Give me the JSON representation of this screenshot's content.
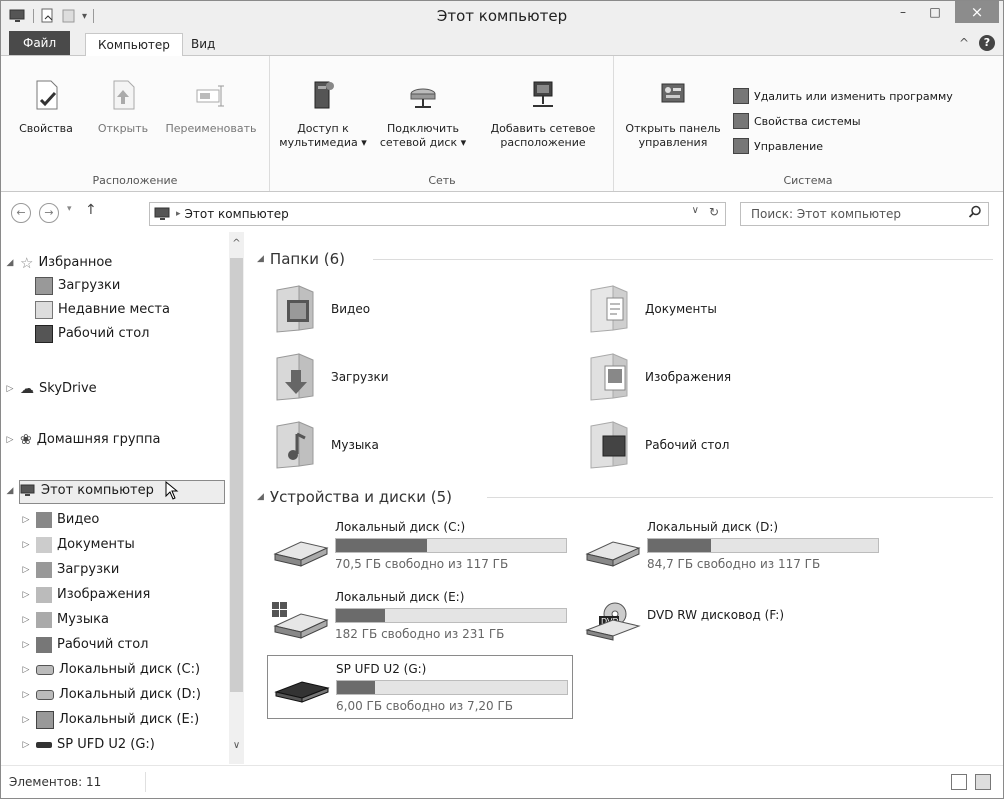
{
  "window": {
    "title": "Этот компьютер",
    "minimize": "–",
    "maximize": "□",
    "close": "×"
  },
  "tabs": {
    "file": "Файл",
    "computer": "Компьютер",
    "view": "Вид",
    "collapse": "^",
    "help": "?"
  },
  "ribbon": {
    "location": {
      "label": "Расположение",
      "properties": "Свойства",
      "open": "Открыть",
      "rename": "Переименовать"
    },
    "network": {
      "label": "Сеть",
      "media_line1": "Доступ к",
      "media_line2": "мультимедиа ▾",
      "map_line1": "Подключить",
      "map_line2": "сетевой диск ▾",
      "add_line1": "Добавить сетевое",
      "add_line2": "расположение"
    },
    "system": {
      "label": "Система",
      "control_line1": "Открыть панель",
      "control_line2": "управления",
      "uninstall": "Удалить или изменить программу",
      "sysprops": "Свойства системы",
      "manage": "Управление"
    }
  },
  "address": {
    "path": "Этот компьютер",
    "search_placeholder": "Поиск: Этот компьютер"
  },
  "nav": {
    "favorites": "Избранное",
    "downloads": "Загрузки",
    "recent": "Недавние места",
    "desktop": "Рабочий стол",
    "skydrive": "SkyDrive",
    "homegroup": "Домашняя группа",
    "thispc": "Этот компьютер",
    "pc_items": [
      "Видео",
      "Документы",
      "Загрузки",
      "Изображения",
      "Музыка",
      "Рабочий стол",
      "Локальный диск (C:)",
      "Локальный диск (D:)",
      "Локальный диск (E:)",
      "SP UFD U2 (G:)"
    ]
  },
  "folders": {
    "header": "Папки (6)",
    "items": [
      "Видео",
      "Документы",
      "Загрузки",
      "Изображения",
      "Музыка",
      "Рабочий стол"
    ]
  },
  "devices": {
    "header": "Устройства и диски (5)",
    "drives": [
      {
        "name": "Локальный диск (C:)",
        "free": "70,5 ГБ свободно из 117 ГБ",
        "used_fraction": 0.397
      },
      {
        "name": "Локальный диск (D:)",
        "free": "84,7 ГБ свободно из 117 ГБ",
        "used_fraction": 0.276
      },
      {
        "name": "Локальный диск (E:)",
        "free": "182 ГБ свободно из 231 ГБ",
        "used_fraction": 0.212
      },
      {
        "name": "DVD RW дисковод (F:)"
      },
      {
        "name": "SP UFD U2 (G:)",
        "free": "6,00 ГБ свободно из 7,20 ГБ",
        "used_fraction": 0.167
      }
    ]
  },
  "status": {
    "count": "Элементов: 11"
  }
}
